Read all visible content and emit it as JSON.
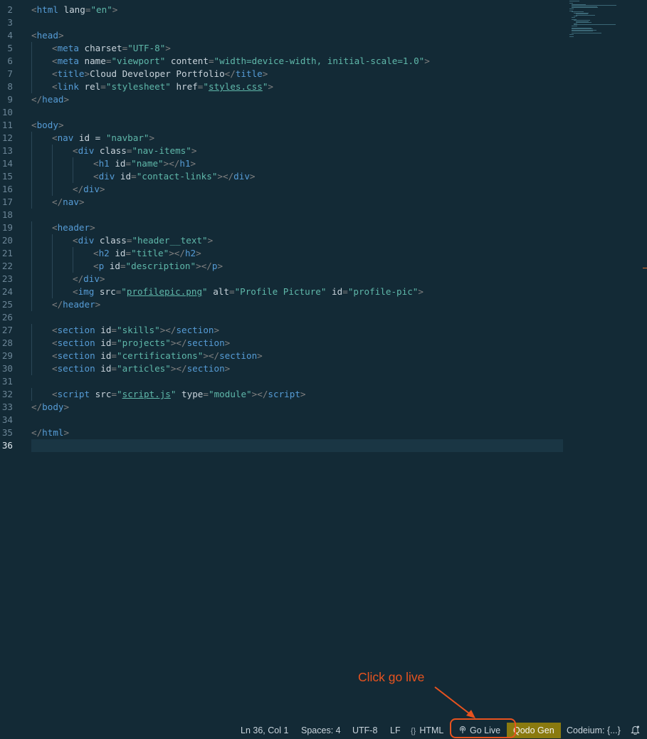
{
  "editor": {
    "lines": [
      {
        "n": "2",
        "indent": 0,
        "tokens": [
          [
            "p",
            "<"
          ],
          [
            "t",
            "html"
          ],
          [
            "a",
            " lang"
          ],
          [
            "p",
            "="
          ],
          [
            "s",
            "\"en\""
          ],
          [
            "p",
            ">"
          ]
        ]
      },
      {
        "n": "3",
        "indent": 0,
        "tokens": []
      },
      {
        "n": "4",
        "indent": 0,
        "tokens": [
          [
            "p",
            "<"
          ],
          [
            "t",
            "head"
          ],
          [
            "p",
            ">"
          ]
        ]
      },
      {
        "n": "5",
        "indent": 1,
        "tokens": [
          [
            "p",
            "<"
          ],
          [
            "t",
            "meta"
          ],
          [
            "a",
            " charset"
          ],
          [
            "p",
            "="
          ],
          [
            "s",
            "\"UTF-8\""
          ],
          [
            "p",
            ">"
          ]
        ]
      },
      {
        "n": "6",
        "indent": 1,
        "tokens": [
          [
            "p",
            "<"
          ],
          [
            "t",
            "meta"
          ],
          [
            "a",
            " name"
          ],
          [
            "p",
            "="
          ],
          [
            "s",
            "\"viewport\""
          ],
          [
            "a",
            " content"
          ],
          [
            "p",
            "="
          ],
          [
            "s",
            "\"width=device-width, initial-scale=1.0\""
          ],
          [
            "p",
            ">"
          ]
        ]
      },
      {
        "n": "7",
        "indent": 1,
        "tokens": [
          [
            "p",
            "<"
          ],
          [
            "t",
            "title"
          ],
          [
            "p",
            ">"
          ],
          [
            "x",
            "Cloud Developer Portfolio"
          ],
          [
            "p",
            "</"
          ],
          [
            "t",
            "title"
          ],
          [
            "p",
            ">"
          ]
        ]
      },
      {
        "n": "8",
        "indent": 1,
        "tokens": [
          [
            "p",
            "<"
          ],
          [
            "t",
            "link"
          ],
          [
            "a",
            " rel"
          ],
          [
            "p",
            "="
          ],
          [
            "s",
            "\"stylesheet\""
          ],
          [
            "a",
            " href"
          ],
          [
            "p",
            "="
          ],
          [
            "s",
            "\""
          ],
          [
            "u",
            "styles.css"
          ],
          [
            "s",
            "\""
          ],
          [
            "p",
            ">"
          ]
        ]
      },
      {
        "n": "9",
        "indent": 0,
        "tokens": [
          [
            "p",
            "</"
          ],
          [
            "t",
            "head"
          ],
          [
            "p",
            ">"
          ]
        ]
      },
      {
        "n": "10",
        "indent": 0,
        "tokens": []
      },
      {
        "n": "11",
        "indent": 0,
        "tokens": [
          [
            "p",
            "<"
          ],
          [
            "t",
            "body"
          ],
          [
            "p",
            ">"
          ]
        ]
      },
      {
        "n": "12",
        "indent": 1,
        "tokens": [
          [
            "p",
            "<"
          ],
          [
            "t",
            "nav"
          ],
          [
            "a",
            " id = "
          ],
          [
            "s",
            "\"navbar\""
          ],
          [
            "p",
            ">"
          ]
        ]
      },
      {
        "n": "13",
        "indent": 2,
        "tokens": [
          [
            "p",
            "<"
          ],
          [
            "t",
            "div"
          ],
          [
            "a",
            " class"
          ],
          [
            "p",
            "="
          ],
          [
            "s",
            "\"nav-items\""
          ],
          [
            "p",
            ">"
          ]
        ]
      },
      {
        "n": "14",
        "indent": 3,
        "tokens": [
          [
            "p",
            "<"
          ],
          [
            "t",
            "h1"
          ],
          [
            "a",
            " id"
          ],
          [
            "p",
            "="
          ],
          [
            "s",
            "\"name\""
          ],
          [
            "p",
            "></"
          ],
          [
            "t",
            "h1"
          ],
          [
            "p",
            ">"
          ]
        ]
      },
      {
        "n": "15",
        "indent": 3,
        "tokens": [
          [
            "p",
            "<"
          ],
          [
            "t",
            "div"
          ],
          [
            "a",
            " id"
          ],
          [
            "p",
            "="
          ],
          [
            "s",
            "\"contact-links\""
          ],
          [
            "p",
            "></"
          ],
          [
            "t",
            "div"
          ],
          [
            "p",
            ">"
          ]
        ]
      },
      {
        "n": "16",
        "indent": 2,
        "tokens": [
          [
            "p",
            "</"
          ],
          [
            "t",
            "div"
          ],
          [
            "p",
            ">"
          ]
        ]
      },
      {
        "n": "17",
        "indent": 1,
        "tokens": [
          [
            "p",
            "</"
          ],
          [
            "t",
            "nav"
          ],
          [
            "p",
            ">"
          ]
        ]
      },
      {
        "n": "18",
        "indent": 0,
        "tokens": []
      },
      {
        "n": "19",
        "indent": 1,
        "tokens": [
          [
            "p",
            "<"
          ],
          [
            "t",
            "header"
          ],
          [
            "p",
            ">"
          ]
        ]
      },
      {
        "n": "20",
        "indent": 2,
        "tokens": [
          [
            "p",
            "<"
          ],
          [
            "t",
            "div"
          ],
          [
            "a",
            " class"
          ],
          [
            "p",
            "="
          ],
          [
            "s",
            "\"header__text\""
          ],
          [
            "p",
            ">"
          ]
        ]
      },
      {
        "n": "21",
        "indent": 3,
        "tokens": [
          [
            "p",
            "<"
          ],
          [
            "t",
            "h2"
          ],
          [
            "a",
            " id"
          ],
          [
            "p",
            "="
          ],
          [
            "s",
            "\"title\""
          ],
          [
            "p",
            "></"
          ],
          [
            "t",
            "h2"
          ],
          [
            "p",
            ">"
          ]
        ]
      },
      {
        "n": "22",
        "indent": 3,
        "tokens": [
          [
            "p",
            "<"
          ],
          [
            "t",
            "p"
          ],
          [
            "a",
            " id"
          ],
          [
            "p",
            "="
          ],
          [
            "s",
            "\"description\""
          ],
          [
            "p",
            "></"
          ],
          [
            "t",
            "p"
          ],
          [
            "p",
            ">"
          ]
        ]
      },
      {
        "n": "23",
        "indent": 2,
        "tokens": [
          [
            "p",
            "</"
          ],
          [
            "t",
            "div"
          ],
          [
            "p",
            ">"
          ]
        ]
      },
      {
        "n": "24",
        "indent": 2,
        "tokens": [
          [
            "p",
            "<"
          ],
          [
            "t",
            "img"
          ],
          [
            "a",
            " src"
          ],
          [
            "p",
            "="
          ],
          [
            "s",
            "\""
          ],
          [
            "u",
            "profilepic.png"
          ],
          [
            "s",
            "\""
          ],
          [
            "a",
            " alt"
          ],
          [
            "p",
            "="
          ],
          [
            "s",
            "\"Profile Picture\""
          ],
          [
            "a",
            " id"
          ],
          [
            "p",
            "="
          ],
          [
            "s",
            "\"profile-pic\""
          ],
          [
            "p",
            ">"
          ]
        ]
      },
      {
        "n": "25",
        "indent": 1,
        "tokens": [
          [
            "p",
            "</"
          ],
          [
            "t",
            "header"
          ],
          [
            "p",
            ">"
          ]
        ]
      },
      {
        "n": "26",
        "indent": 0,
        "tokens": []
      },
      {
        "n": "27",
        "indent": 1,
        "tokens": [
          [
            "p",
            "<"
          ],
          [
            "t",
            "section"
          ],
          [
            "a",
            " id"
          ],
          [
            "p",
            "="
          ],
          [
            "s",
            "\"skills\""
          ],
          [
            "p",
            "></"
          ],
          [
            "t",
            "section"
          ],
          [
            "p",
            ">"
          ]
        ]
      },
      {
        "n": "28",
        "indent": 1,
        "tokens": [
          [
            "p",
            "<"
          ],
          [
            "t",
            "section"
          ],
          [
            "a",
            " id"
          ],
          [
            "p",
            "="
          ],
          [
            "s",
            "\"projects\""
          ],
          [
            "p",
            "></"
          ],
          [
            "t",
            "section"
          ],
          [
            "p",
            ">"
          ]
        ]
      },
      {
        "n": "29",
        "indent": 1,
        "tokens": [
          [
            "p",
            "<"
          ],
          [
            "t",
            "section"
          ],
          [
            "a",
            " id"
          ],
          [
            "p",
            "="
          ],
          [
            "s",
            "\"certifications\""
          ],
          [
            "p",
            "></"
          ],
          [
            "t",
            "section"
          ],
          [
            "p",
            ">"
          ]
        ]
      },
      {
        "n": "30",
        "indent": 1,
        "tokens": [
          [
            "p",
            "<"
          ],
          [
            "t",
            "section"
          ],
          [
            "a",
            " id"
          ],
          [
            "p",
            "="
          ],
          [
            "s",
            "\"articles\""
          ],
          [
            "p",
            "></"
          ],
          [
            "t",
            "section"
          ],
          [
            "p",
            ">"
          ]
        ]
      },
      {
        "n": "31",
        "indent": 0,
        "tokens": []
      },
      {
        "n": "32",
        "indent": 1,
        "tokens": [
          [
            "p",
            "<"
          ],
          [
            "t",
            "script"
          ],
          [
            "a",
            " src"
          ],
          [
            "p",
            "="
          ],
          [
            "s",
            "\""
          ],
          [
            "u",
            "script.js"
          ],
          [
            "s",
            "\""
          ],
          [
            "a",
            " type"
          ],
          [
            "p",
            "="
          ],
          [
            "s",
            "\"module\""
          ],
          [
            "p",
            "></"
          ],
          [
            "t",
            "script"
          ],
          [
            "p",
            ">"
          ]
        ]
      },
      {
        "n": "33",
        "indent": 0,
        "tokens": [
          [
            "p",
            "</"
          ],
          [
            "t",
            "body"
          ],
          [
            "p",
            ">"
          ]
        ]
      },
      {
        "n": "34",
        "indent": 0,
        "tokens": []
      },
      {
        "n": "35",
        "indent": 0,
        "tokens": [
          [
            "p",
            "</"
          ],
          [
            "t",
            "html"
          ],
          [
            "p",
            ">"
          ]
        ]
      },
      {
        "n": "36",
        "indent": 0,
        "tokens": [],
        "active": true
      }
    ]
  },
  "statusbar": {
    "cursor": "Ln 36, Col 1",
    "spaces": "Spaces: 4",
    "encoding": "UTF-8",
    "eol": "LF",
    "language_icon": "{}",
    "language": "HTML",
    "go_live_icon": "broadcast-icon",
    "go_live": "Go Live",
    "qodo": "Qodo Gen",
    "codeium": "Codeium: {...}",
    "bell_icon": "bell-icon"
  },
  "annotation": {
    "text": "Click go live",
    "color": "#e8531f"
  }
}
